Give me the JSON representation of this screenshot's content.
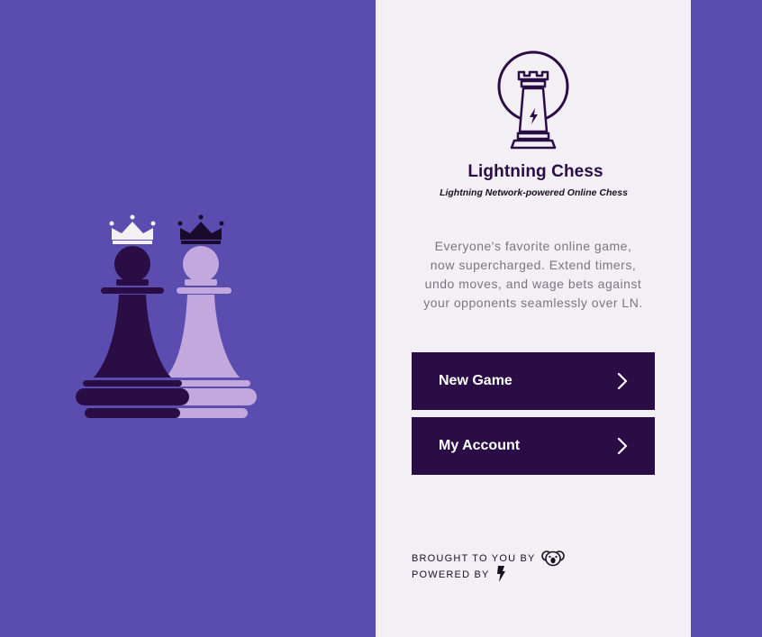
{
  "app": {
    "title": "Lightning Chess",
    "tagline": "Lightning Network-powered Online Chess"
  },
  "description": {
    "lines": [
      "Everyone's favorite online game,",
      "now supercharged. Extend timers,",
      "undo moves, and wage bets against",
      "your opponents seamlessly over LN."
    ]
  },
  "actions": {
    "new_game": "New Game",
    "my_account": "My Account"
  },
  "credits": {
    "brought_by": "BROUGHT TO YOU BY",
    "powered_by": "POWERED BY"
  },
  "icons": {
    "logo": "rook-lightning-logo-icon",
    "hero": "crowned-pawns-icon",
    "chevron": "chevron-right-icon",
    "sponsor": "koala-icon",
    "lightning": "lightning-bolt-icon"
  },
  "colors": {
    "background": "#5b4caf",
    "panel": "#f2f0f4",
    "primary": "#2a0d45",
    "pawn_light": "#c2a8dc",
    "crown_light": "#f2f0f4"
  }
}
